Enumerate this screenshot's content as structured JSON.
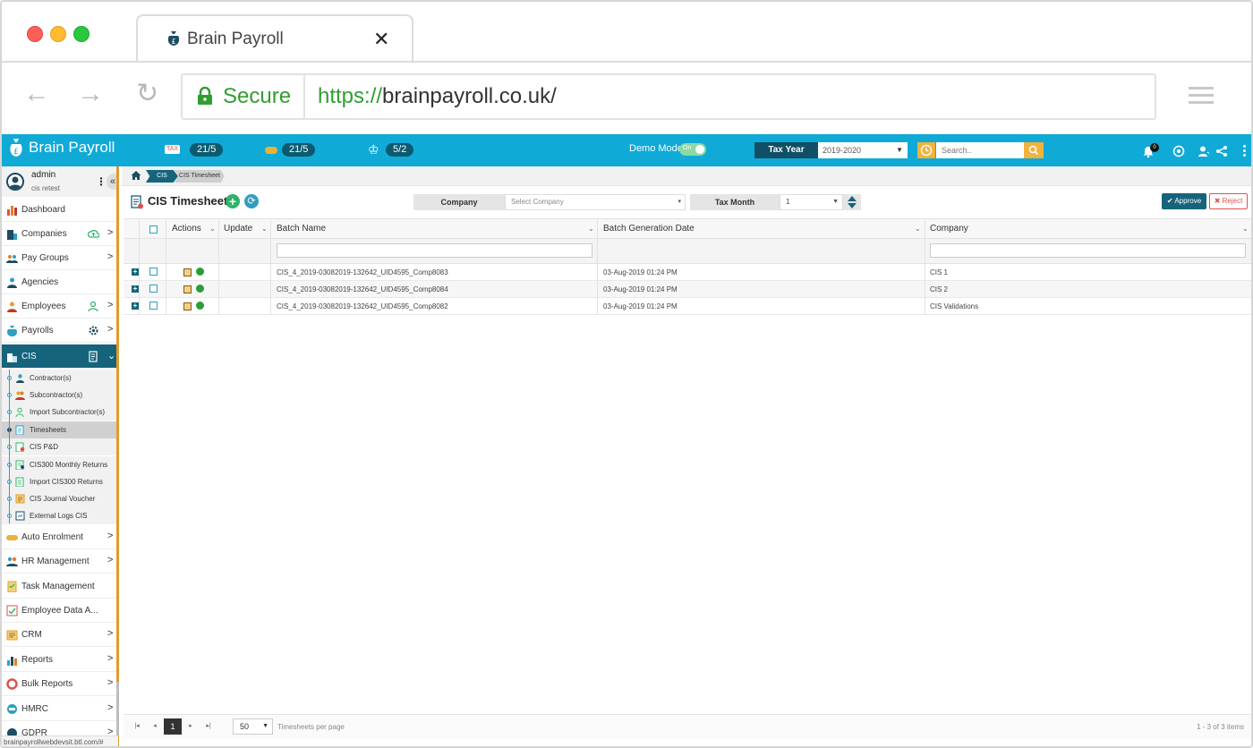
{
  "browser": {
    "tab_title": "Brain Payroll",
    "close_glyph": "✕",
    "secure_label": "Secure",
    "url_protocol": "https://",
    "url_rest": "brainpayroll.co.uk/",
    "back_glyph": "←",
    "forward_glyph": "→",
    "reload_glyph": "↻"
  },
  "header": {
    "logo_text": "Brain Payroll",
    "stats": [
      {
        "icon": "tax-icon",
        "icon_text": "TAX",
        "value": "21/5"
      },
      {
        "icon": "pension-icon",
        "icon_text": "",
        "value": "21/5"
      },
      {
        "icon": "crown-icon",
        "icon_text": "♔",
        "value": "5/2"
      }
    ],
    "demo_mode_label": "Demo Mode",
    "demo_toggle_text": "On",
    "tax_year_label": "Tax Year",
    "tax_year_value": "2019-2020",
    "search_placeholder": "Search..",
    "notification_count": "0",
    "brand_color": "#10aad6",
    "accent_color": "#15647c"
  },
  "user": {
    "name": "admin",
    "subtitle": "cis retest",
    "collapse_glyph": "«"
  },
  "sidebar": {
    "items": [
      {
        "label": "Dashboard",
        "icon": "chart-icon"
      },
      {
        "label": "Companies",
        "icon": "building-icon",
        "right_icon": "cloud-upload-icon",
        "chevron": ">"
      },
      {
        "label": "Pay Groups",
        "icon": "users-icon",
        "chevron": ">"
      },
      {
        "label": "Agencies",
        "icon": "agency-icon"
      },
      {
        "label": "Employees",
        "icon": "employees-icon",
        "right_icon": "add-user-icon",
        "chevron": ">"
      },
      {
        "label": "Payrolls",
        "icon": "money-bag-icon",
        "right_icon": "gear-icon",
        "chevron": ">"
      },
      {
        "label": "CIS",
        "icon": "cis-icon",
        "right_icon": "document-icon",
        "chevron": "⌄"
      }
    ],
    "cis_sub": [
      {
        "label": "Contractor(s)",
        "icon": "contractor-icon"
      },
      {
        "label": "Subcontractor(s)",
        "icon": "subcontractor-icon"
      },
      {
        "label": "Import Subcontractor(s)",
        "icon": "import-user-icon"
      },
      {
        "label": "Timesheets",
        "icon": "timesheet-icon"
      },
      {
        "label": "CIS P&D",
        "icon": "pd-icon"
      },
      {
        "label": "CIS300 Monthly Returns",
        "icon": "returns-icon"
      },
      {
        "label": "Import CIS300 Returns",
        "icon": "import-returns-icon"
      },
      {
        "label": "CIS Journal Voucher",
        "icon": "journal-icon"
      },
      {
        "label": "External Logs CIS",
        "icon": "logs-icon"
      }
    ],
    "items2": [
      {
        "label": "Auto Enrolment",
        "icon": "pension-icon",
        "chevron": ">"
      },
      {
        "label": "HR Management",
        "icon": "hr-icon",
        "chevron": ">"
      },
      {
        "label": "Task Management",
        "icon": "task-icon"
      },
      {
        "label": "Employee Data A...",
        "icon": "data-icon"
      },
      {
        "label": "CRM",
        "icon": "crm-icon",
        "chevron": ">"
      },
      {
        "label": "Reports",
        "icon": "reports-icon",
        "chevron": ">"
      },
      {
        "label": "Bulk Reports",
        "icon": "bulk-reports-icon",
        "chevron": ">"
      },
      {
        "label": "HMRC",
        "icon": "hmrc-icon",
        "chevron": ">"
      },
      {
        "label": "GDPR",
        "icon": "gdpr-icon",
        "chevron": ">"
      }
    ],
    "status_url": "brainpayrollwebdevsit.btl.com/#"
  },
  "breadcrumb": {
    "level1": "CIS",
    "level2": "CIS Timesheet"
  },
  "page": {
    "title": "CIS Timesheets",
    "add_glyph": "+",
    "refresh_glyph": "⟳",
    "company_label": "Company",
    "company_placeholder": "Select Company",
    "tax_month_label": "Tax Month",
    "tax_month_value": "1",
    "approve_label": "Approve",
    "reject_label": "Reject"
  },
  "grid": {
    "columns": [
      "Actions",
      "Update",
      "Batch Name",
      "Batch Generation Date",
      "Company"
    ],
    "rows": [
      {
        "batch_name": "CIS_4_2019-03082019-132642_UID4595_Comp8083",
        "date": "03-Aug-2019 01:24 PM",
        "company": "CIS 1"
      },
      {
        "batch_name": "CIS_4_2019-03082019-132642_UID4595_Comp8084",
        "date": "03-Aug-2019 01:24 PM",
        "company": "CIS 2"
      },
      {
        "batch_name": "CIS_4_2019-03082019-132642_UID4595_Comp8082",
        "date": "03-Aug-2019 01:24 PM",
        "company": "CIS Validations"
      }
    ]
  },
  "pager": {
    "first": "|◂",
    "prev": "◂",
    "current_page": "1",
    "next": "▸",
    "last": "▸|",
    "page_size": "50",
    "per_page_label": "Timesheets per page",
    "info": "1 - 3 of 3 items"
  }
}
